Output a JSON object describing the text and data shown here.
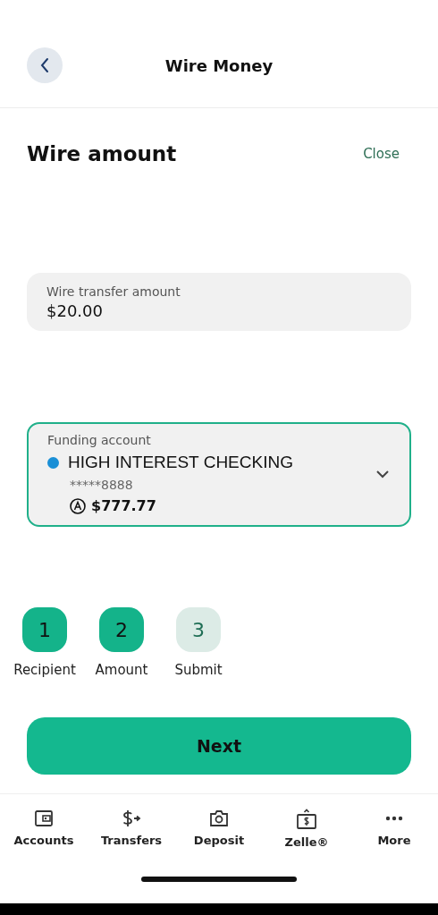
{
  "header": {
    "title": "Wire Money"
  },
  "section": {
    "title": "Wire amount",
    "close": "Close"
  },
  "amount_field": {
    "label": "Wire transfer amount",
    "value": "$20.00"
  },
  "funding_account": {
    "label": "Funding account",
    "name": "HIGH INTEREST CHECKING",
    "color": "#1a8fd6",
    "number": "*****8888",
    "balance": "$777.77"
  },
  "steps": [
    {
      "number": "1",
      "label": "Recipient",
      "done": true
    },
    {
      "number": "2",
      "label": "Amount",
      "done": true
    },
    {
      "number": "3",
      "label": "Submit",
      "done": false
    }
  ],
  "next_button": "Next",
  "nav": [
    {
      "kind": "wallet",
      "label": "Accounts"
    },
    {
      "kind": "transfer",
      "label": "Transfers"
    },
    {
      "kind": "camera",
      "label": "Deposit"
    },
    {
      "kind": "bill",
      "label": "Zelle®"
    },
    {
      "kind": "dots",
      "label": "More"
    }
  ]
}
